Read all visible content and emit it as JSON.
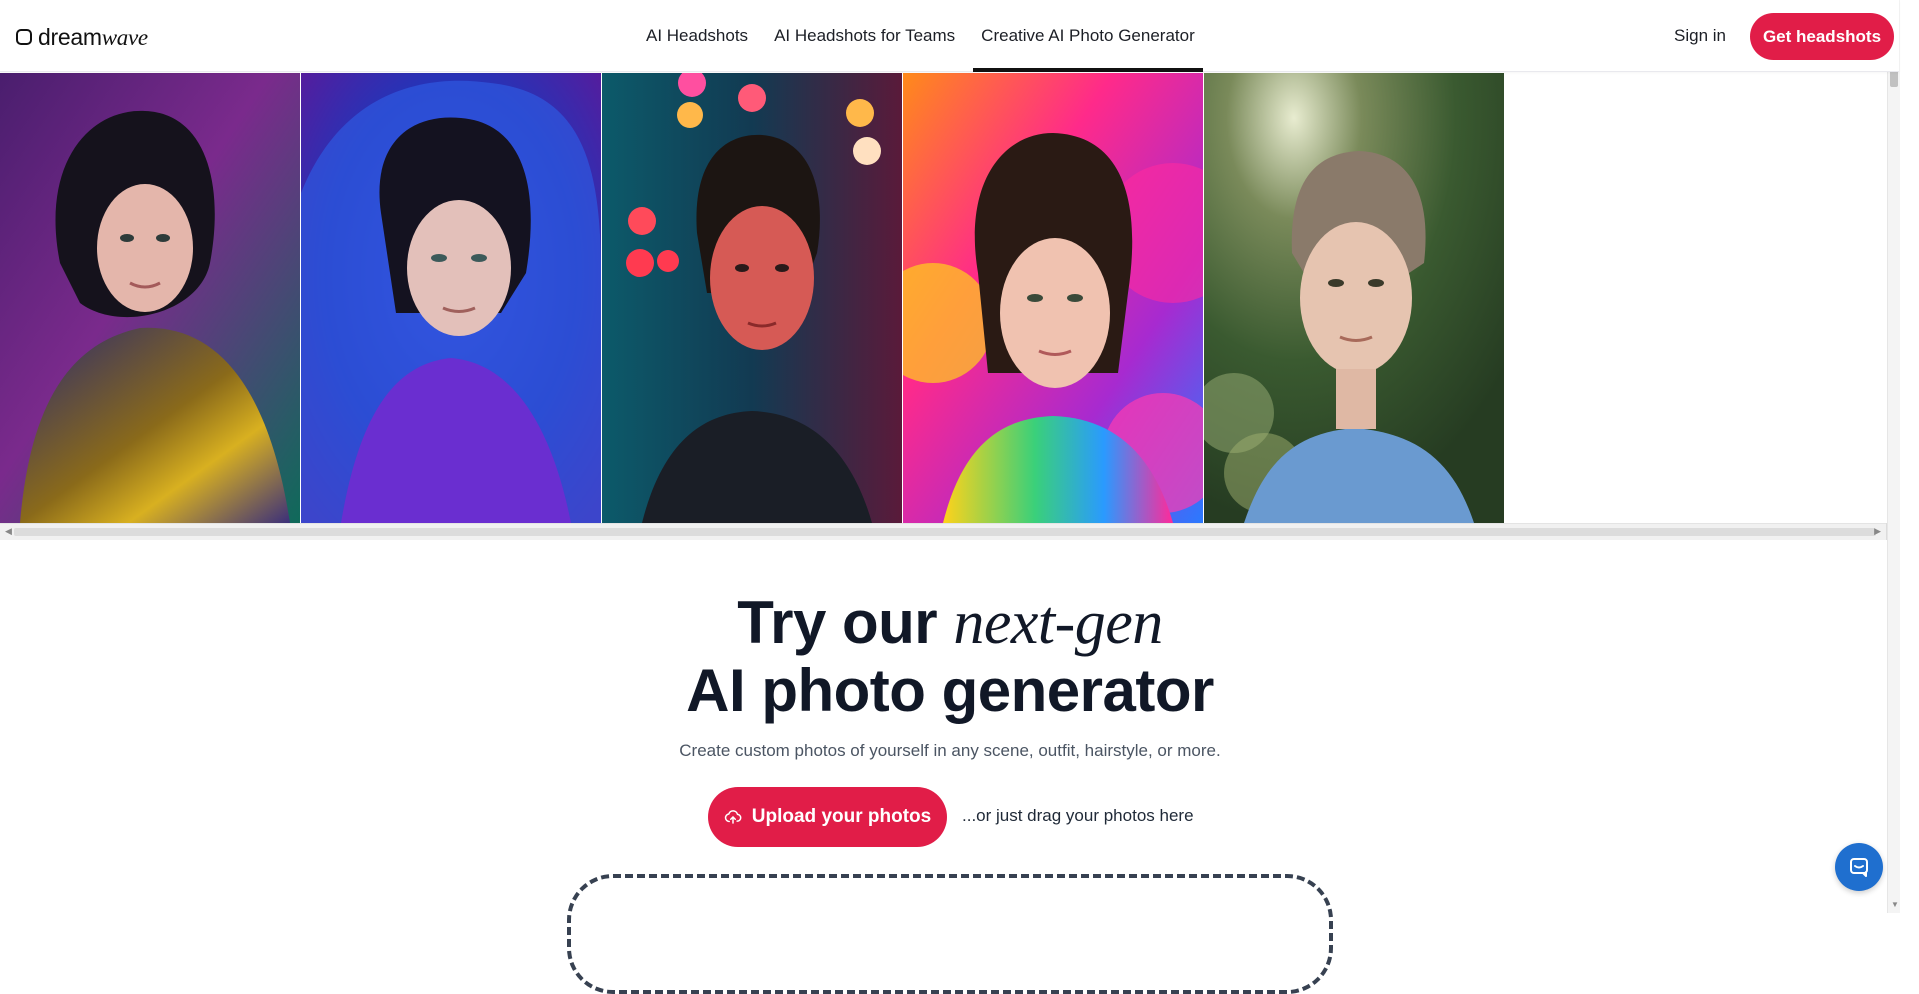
{
  "brand": {
    "name_part1": "dream",
    "name_part2": "wave"
  },
  "nav": {
    "items": [
      {
        "label": "AI Headshots"
      },
      {
        "label": "AI Headshots for Teams"
      },
      {
        "label": "Creative AI Photo Generator",
        "active": true
      }
    ],
    "sign_in": "Sign in",
    "cta": "Get headshots"
  },
  "gallery": {
    "photos": [
      {
        "style": "iridescent cloak, purple-teal studio backdrop"
      },
      {
        "style": "swirling blue fabric veil"
      },
      {
        "style": "neon bokeh night, red light"
      },
      {
        "style": "colorful powder explosion"
      },
      {
        "style": "outdoor sunlight, short hair, blue t-shirt"
      }
    ]
  },
  "hero": {
    "title_line1_prefix": "Try our",
    "title_line1_italic": "next-gen",
    "title_line2": "AI photo generator",
    "subtitle": "Create custom photos of yourself in any scene, outfit, hairstyle, or more.",
    "upload_label": "Upload your photos",
    "drag_hint": "...or just drag your photos here"
  },
  "colors": {
    "accent": "#e11d48",
    "chat": "#1f6fcf",
    "text": "#111827"
  },
  "icons": {
    "logo": "rounded-square-icon",
    "upload": "cloud-upload-icon",
    "chat": "chat-bubble-icon"
  }
}
